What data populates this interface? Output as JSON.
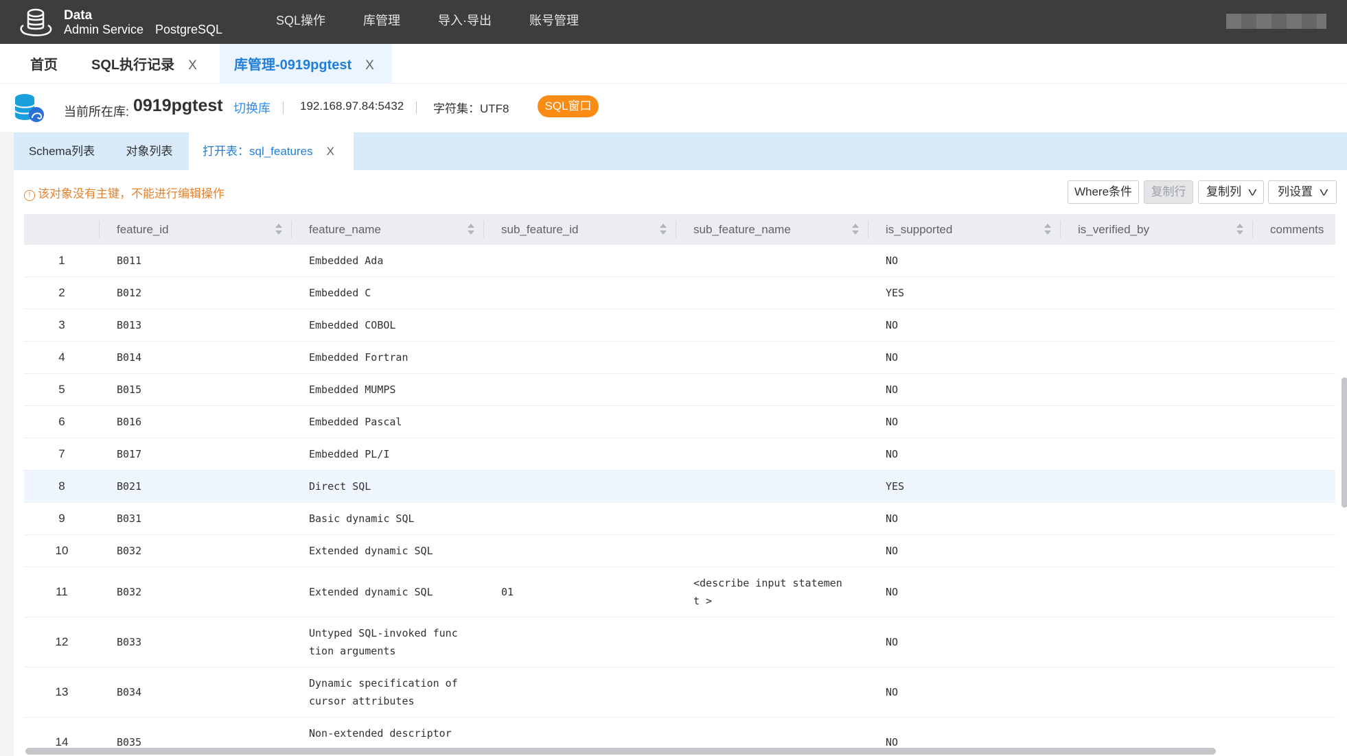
{
  "header": {
    "brand_line1": "Data",
    "brand_line2": "Admin Service",
    "db_type": "PostgreSQL",
    "nav": [
      "SQL操作",
      "库管理",
      "导入·导出",
      "账号管理"
    ]
  },
  "tabs": [
    {
      "label": "首页",
      "closable": false
    },
    {
      "label": "SQL执行记录",
      "closable": true
    },
    {
      "label": "库管理-0919pgtest",
      "closable": true,
      "active": true
    }
  ],
  "close_glyph": "X",
  "info": {
    "current_db_label": "当前所在库:",
    "db_name": "0919pgtest",
    "switch_label": "切换库",
    "host": "192.168.97.84:5432",
    "charset": "字符集：UTF8",
    "sql_window_label": "SQL窗口"
  },
  "subtabs": [
    {
      "label": "Schema列表"
    },
    {
      "label": "对象列表"
    },
    {
      "label": "打开表：sql_features",
      "active": true,
      "closable": true
    }
  ],
  "warning": {
    "icon": "!",
    "text": "该对象没有主键，不能进行编辑操作"
  },
  "toolbar": {
    "where_label": "Where条件",
    "copy_row_label": "复制行",
    "copy_col_label": "复制列",
    "col_settings_label": "列设置",
    "chevron": "V"
  },
  "table": {
    "columns": [
      "",
      "feature_id",
      "feature_name",
      "sub_feature_id",
      "sub_feature_name",
      "is_supported",
      "is_verified_by",
      "comments"
    ],
    "rows": [
      {
        "no": "1",
        "feature_id": "B011",
        "feature_name": "Embedded Ada",
        "sub_feature_id": "",
        "sub_feature_name": "",
        "is_supported": "NO"
      },
      {
        "no": "2",
        "feature_id": "B012",
        "feature_name": "Embedded C",
        "sub_feature_id": "",
        "sub_feature_name": "",
        "is_supported": "YES"
      },
      {
        "no": "3",
        "feature_id": "B013",
        "feature_name": "Embedded COBOL",
        "sub_feature_id": "",
        "sub_feature_name": "",
        "is_supported": "NO"
      },
      {
        "no": "4",
        "feature_id": "B014",
        "feature_name": "Embedded Fortran",
        "sub_feature_id": "",
        "sub_feature_name": "",
        "is_supported": "NO"
      },
      {
        "no": "5",
        "feature_id": "B015",
        "feature_name": "Embedded MUMPS",
        "sub_feature_id": "",
        "sub_feature_name": "",
        "is_supported": "NO"
      },
      {
        "no": "6",
        "feature_id": "B016",
        "feature_name": "Embedded Pascal",
        "sub_feature_id": "",
        "sub_feature_name": "",
        "is_supported": "NO"
      },
      {
        "no": "7",
        "feature_id": "B017",
        "feature_name": "Embedded PL/I",
        "sub_feature_id": "",
        "sub_feature_name": "",
        "is_supported": "NO"
      },
      {
        "no": "8",
        "feature_id": "B021",
        "feature_name": "Direct SQL",
        "sub_feature_id": "",
        "sub_feature_name": "",
        "is_supported": "YES",
        "highlight": true
      },
      {
        "no": "9",
        "feature_id": "B031",
        "feature_name": "Basic dynamic SQL",
        "sub_feature_id": "",
        "sub_feature_name": "",
        "is_supported": "NO"
      },
      {
        "no": "10",
        "feature_id": "B032",
        "feature_name": "Extended dynamic SQL",
        "sub_feature_id": "",
        "sub_feature_name": "",
        "is_supported": "NO"
      },
      {
        "no": "11",
        "feature_id": "B032",
        "feature_name": "Extended dynamic SQL",
        "sub_feature_id": "01",
        "sub_feature_name": "<describe input statement >",
        "is_supported": "NO"
      },
      {
        "no": "12",
        "feature_id": "B033",
        "feature_name": "Untyped SQL-invoked function arguments",
        "sub_feature_id": "",
        "sub_feature_name": "",
        "is_supported": "NO"
      },
      {
        "no": "13",
        "feature_id": "B034",
        "feature_name": "Dynamic specification of cursor attributes",
        "sub_feature_id": "",
        "sub_feature_name": "",
        "is_supported": "NO"
      },
      {
        "no": "14",
        "feature_id": "B035",
        "feature_name": "Non-extended descriptor n",
        "sub_feature_id": "",
        "sub_feature_name": "",
        "is_supported": "NO"
      }
    ]
  }
}
